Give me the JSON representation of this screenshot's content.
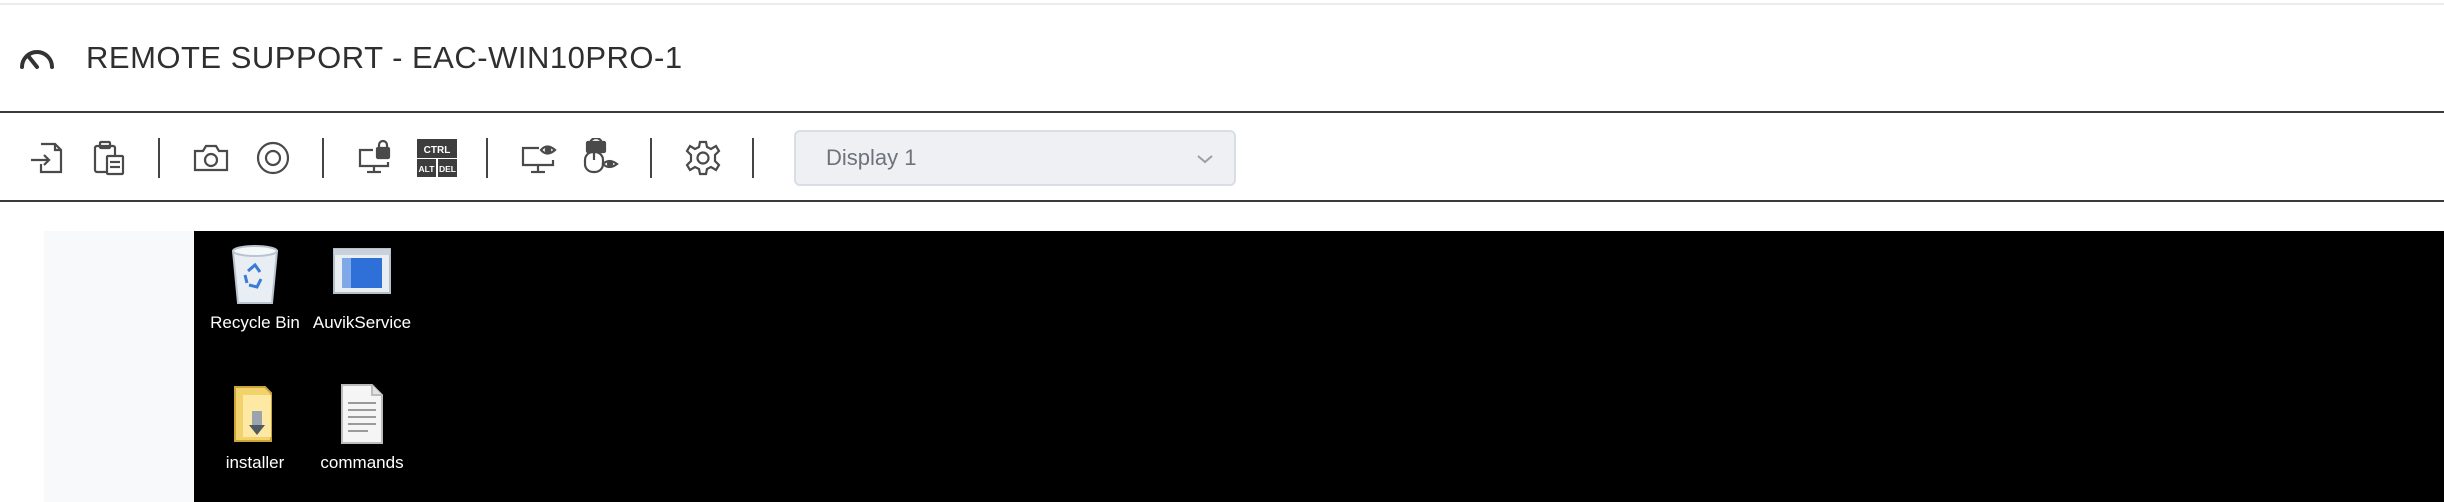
{
  "title_bar": {
    "icon": "gauge-icon",
    "title": "REMOTE SUPPORT - EAC-WIN10PRO-1"
  },
  "toolbar": {
    "tools": [
      {
        "icon": "file-transfer-icon"
      },
      {
        "icon": "clipboard-icon"
      },
      {
        "icon": "camera-icon"
      },
      {
        "icon": "record-icon"
      },
      {
        "icon": "lock-screen-icon"
      },
      {
        "icon": "ctrl-alt-del-icon",
        "line1": "CTRL",
        "line2a": "ALT",
        "line2b": "DEL"
      },
      {
        "icon": "screen-view-icon"
      },
      {
        "icon": "mouse-lock-icon"
      },
      {
        "icon": "gear-icon"
      }
    ],
    "display_select": {
      "value": "Display 1",
      "icon": "chevron-down-icon"
    }
  },
  "desktop": {
    "icons": [
      {
        "label": "Recycle Bin",
        "icon": "recycle-bin-icon"
      },
      {
        "label": "AuvikService",
        "icon": "application-icon"
      },
      {
        "label": "installer",
        "icon": "folder-icon"
      },
      {
        "label": "commands",
        "icon": "text-file-icon"
      }
    ]
  },
  "colors": {
    "screen_bg": "#000000",
    "toolbar_icon": "#4a4a4a",
    "select_bg": "#eef0f4",
    "select_text": "#6e737b"
  }
}
